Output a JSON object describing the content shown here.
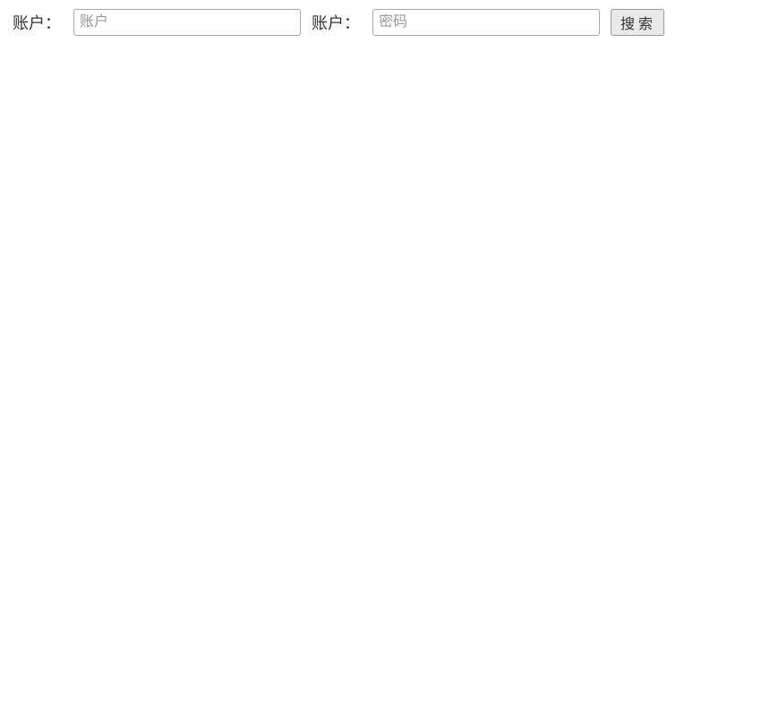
{
  "form": {
    "account_label": "账户：",
    "account_input": {
      "value": "",
      "placeholder": "账户"
    },
    "password_label": "账户：",
    "password_input": {
      "value": "",
      "placeholder": "密码"
    },
    "search_button_label": "搜索"
  }
}
